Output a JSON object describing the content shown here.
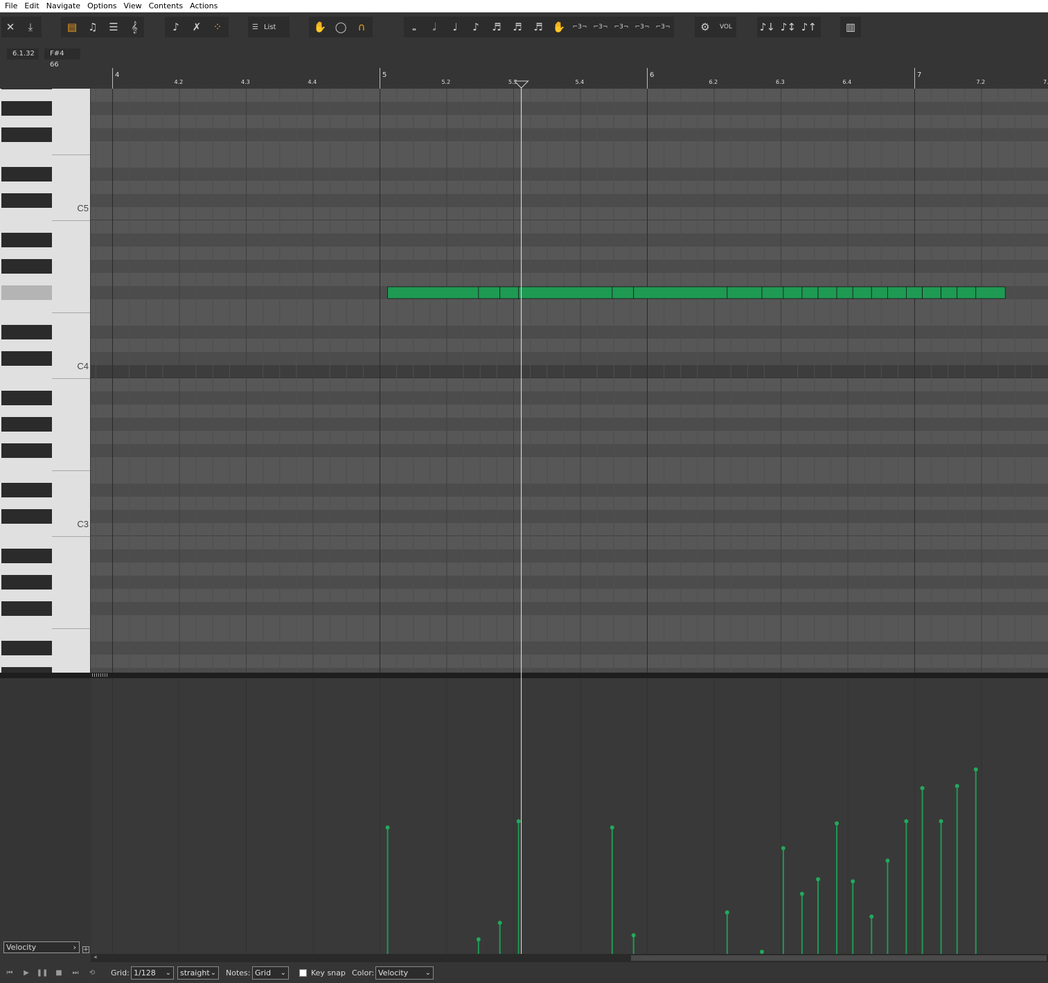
{
  "menu": [
    "File",
    "Edit",
    "Navigate",
    "Options",
    "View",
    "Contents",
    "Actions"
  ],
  "toolbar": {
    "list_label": "List",
    "vol_label": "VOL"
  },
  "status": {
    "position": "6.1.32",
    "note_info": "F#4  66"
  },
  "ruler": {
    "major": [
      {
        "label": "4",
        "beat": 4
      },
      {
        "label": "5",
        "beat": 5
      },
      {
        "label": "6",
        "beat": 6
      },
      {
        "label": "7",
        "beat": 7
      }
    ],
    "minor": [
      {
        "label": "4.2",
        "beat": 4.25
      },
      {
        "label": "4.3",
        "beat": 4.5
      },
      {
        "label": "4.4",
        "beat": 4.75
      },
      {
        "label": "5.2",
        "beat": 5.25
      },
      {
        "label": "5.3",
        "beat": 5.5
      },
      {
        "label": "5.4",
        "beat": 5.75
      },
      {
        "label": "6.2",
        "beat": 6.25
      },
      {
        "label": "6.3",
        "beat": 6.5
      },
      {
        "label": "6.4",
        "beat": 6.75
      },
      {
        "label": "7.2",
        "beat": 7.25
      },
      {
        "label": "7.3",
        "beat": 7.5
      }
    ]
  },
  "piano": {
    "octave_labels": [
      "C5",
      "C4",
      "C3"
    ],
    "highlighted_key": "F#4"
  },
  "playhead_position": 5.53,
  "notes": {
    "pitch": "F#4",
    "color": "#1e9a53",
    "segments": [
      {
        "start": 5.03,
        "end": 5.37
      },
      {
        "start": 5.37,
        "end": 5.45
      },
      {
        "start": 5.45,
        "end": 5.52
      },
      {
        "start": 5.52,
        "end": 5.87
      },
      {
        "start": 5.87,
        "end": 5.95
      },
      {
        "start": 5.95,
        "end": 6.3
      },
      {
        "start": 6.3,
        "end": 6.43
      },
      {
        "start": 6.43,
        "end": 6.51
      },
      {
        "start": 6.51,
        "end": 6.58
      },
      {
        "start": 6.58,
        "end": 6.64
      },
      {
        "start": 6.64,
        "end": 6.71
      },
      {
        "start": 6.71,
        "end": 6.77
      },
      {
        "start": 6.77,
        "end": 6.84
      },
      {
        "start": 6.84,
        "end": 6.9
      },
      {
        "start": 6.9,
        "end": 6.97
      },
      {
        "start": 6.97,
        "end": 7.03
      },
      {
        "start": 7.03,
        "end": 7.1
      },
      {
        "start": 7.1,
        "end": 7.16
      },
      {
        "start": 7.16,
        "end": 7.23
      },
      {
        "start": 7.23,
        "end": 7.34
      }
    ]
  },
  "velocities": [
    {
      "pos": 5.03,
      "value": 61
    },
    {
      "pos": 5.37,
      "value": 7
    },
    {
      "pos": 5.45,
      "value": 15
    },
    {
      "pos": 5.52,
      "value": 64
    },
    {
      "pos": 5.87,
      "value": 61
    },
    {
      "pos": 5.95,
      "value": 9
    },
    {
      "pos": 6.3,
      "value": 20
    },
    {
      "pos": 6.43,
      "value": 1
    },
    {
      "pos": 6.51,
      "value": 51
    },
    {
      "pos": 6.58,
      "value": 29
    },
    {
      "pos": 6.64,
      "value": 36
    },
    {
      "pos": 6.71,
      "value": 63
    },
    {
      "pos": 6.77,
      "value": 35
    },
    {
      "pos": 6.84,
      "value": 18
    },
    {
      "pos": 6.9,
      "value": 45
    },
    {
      "pos": 6.97,
      "value": 64
    },
    {
      "pos": 7.03,
      "value": 80
    },
    {
      "pos": 7.1,
      "value": 64
    },
    {
      "pos": 7.16,
      "value": 81
    },
    {
      "pos": 7.23,
      "value": 89
    }
  ],
  "velocity_lane": {
    "label": "Velocity",
    "add_label": "+"
  },
  "bottom": {
    "grid_label": "Grid:",
    "grid_value": "1/128",
    "grid_mode": "straight",
    "notes_label": "Notes:",
    "notes_value": "Grid",
    "key_snap_label": "Key snap",
    "key_snap_checked": false,
    "color_label": "Color:",
    "color_value": "Velocity"
  }
}
